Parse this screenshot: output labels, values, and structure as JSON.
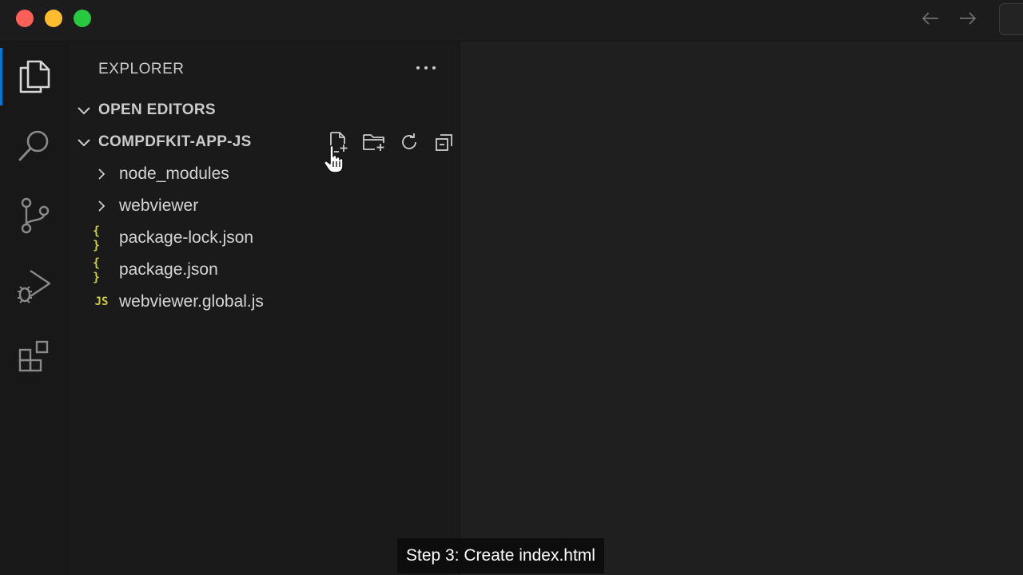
{
  "window": {
    "traffic_lights": [
      "close",
      "minimize",
      "maximize"
    ],
    "colors": {
      "close": "#fe5f57",
      "minimize": "#febc2e",
      "maximize": "#28c840",
      "accent": "#0078d4",
      "file_icon": "#cbcb41"
    }
  },
  "activity_bar": {
    "items": [
      {
        "icon": "files-icon",
        "active": true
      },
      {
        "icon": "search-icon",
        "active": false
      },
      {
        "icon": "source-control-icon",
        "active": false
      },
      {
        "icon": "run-debug-icon",
        "active": false
      },
      {
        "icon": "extensions-icon",
        "active": false
      }
    ]
  },
  "sidebar": {
    "title": "EXPLORER",
    "more_label": "···",
    "sections": {
      "open_editors": "OPEN EDITORS",
      "project": "COMPDFKIT-APP-JS"
    },
    "project_actions": [
      "new-file-icon",
      "new-folder-icon",
      "refresh-icon",
      "collapse-all-icon"
    ],
    "tree": [
      {
        "label": "node_modules",
        "type": "folder",
        "icon_text": ""
      },
      {
        "label": "webviewer",
        "type": "folder",
        "icon_text": ""
      },
      {
        "label": "package-lock.json",
        "type": "json",
        "icon_text": "{ }"
      },
      {
        "label": "package.json",
        "type": "json",
        "icon_text": "{ }"
      },
      {
        "label": "webviewer.global.js",
        "type": "js",
        "icon_text": "JS"
      }
    ]
  },
  "caption": "Step 3: Create index.html"
}
